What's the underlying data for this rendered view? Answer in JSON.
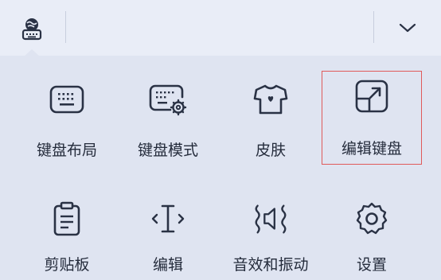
{
  "toolbar": {
    "logo_icon": "globe-keyboard-icon",
    "collapse_icon": "chevron-down-icon"
  },
  "menu": {
    "items": [
      {
        "label": "键盘布局",
        "icon": "keyboard-layout-icon"
      },
      {
        "label": "键盘模式",
        "icon": "keyboard-mode-icon"
      },
      {
        "label": "皮肤",
        "icon": "skin-tshirt-icon"
      },
      {
        "label": "编辑键盘",
        "icon": "edit-keyboard-icon",
        "highlighted": true
      },
      {
        "label": "剪贴板",
        "icon": "clipboard-icon"
      },
      {
        "label": "编辑",
        "icon": "text-cursor-icon"
      },
      {
        "label": "音效和振动",
        "icon": "sound-vibration-icon"
      },
      {
        "label": "设置",
        "icon": "gear-icon"
      }
    ]
  },
  "colors": {
    "background": "#dfe4f1",
    "toolbar": "#e9edf7",
    "icon_stroke": "#2a3245",
    "highlight_border": "#e05a5a"
  }
}
